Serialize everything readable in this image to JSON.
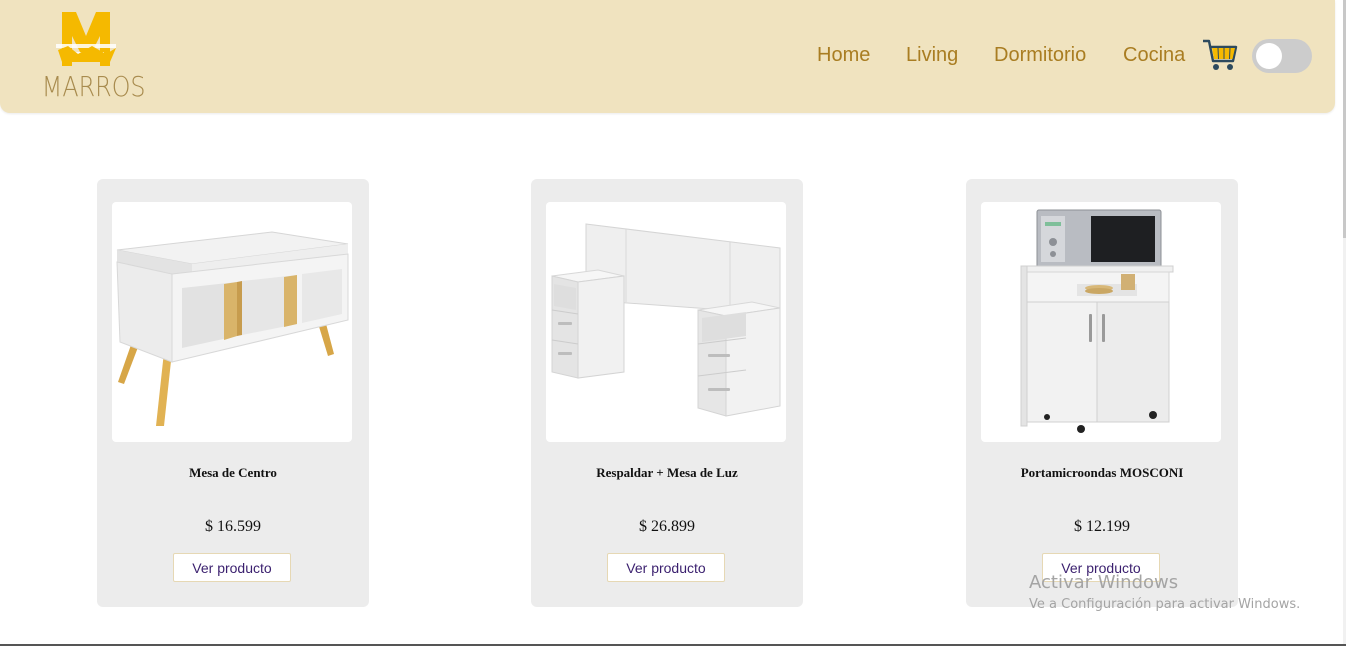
{
  "brand": {
    "logo_letter": "M",
    "name": "MARROS"
  },
  "nav": {
    "items": [
      "Home",
      "Living",
      "Dormitorio",
      "Cocina"
    ]
  },
  "products": [
    {
      "name": "Mesa de Centro",
      "price": "$ 16.599",
      "button": "Ver producto"
    },
    {
      "name": "Respaldar + Mesa de Luz",
      "price": "$ 26.899",
      "button": "Ver producto"
    },
    {
      "name": "Portamicroondas MOSCONI",
      "price": "$ 12.199",
      "button": "Ver producto"
    }
  ],
  "watermark": {
    "line1": "Activar Windows",
    "line2": "Ve a Configuración para activar Windows."
  },
  "colors": {
    "header_bg": "#f0e3bf",
    "accent": "#a97d22",
    "logo_yellow": "#f5b900",
    "card_bg": "#ececec"
  },
  "icons": [
    "cart-icon",
    "theme-toggle"
  ]
}
